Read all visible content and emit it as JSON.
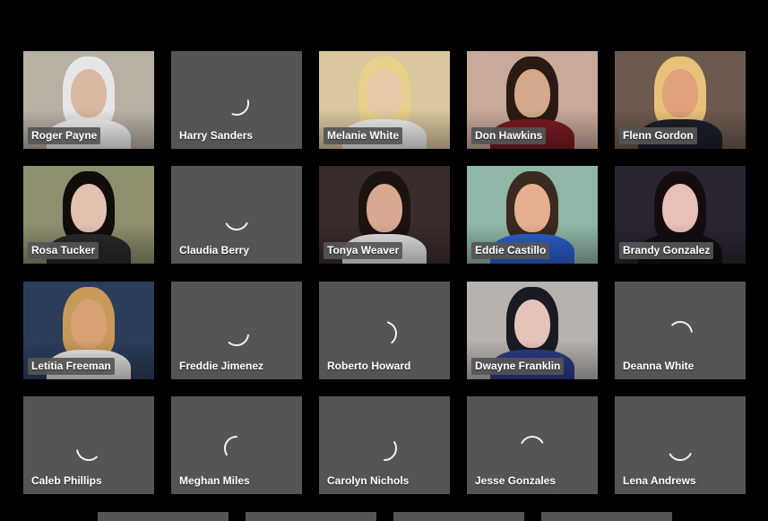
{
  "participants": [
    {
      "name": "Roger Payne",
      "video": true,
      "bg": "#b9b0a4",
      "skin": "#d9b7a0",
      "hair": "#e6e6e6",
      "shirt": "#f2f2f2"
    },
    {
      "name": "Harry Sanders",
      "video": false
    },
    {
      "name": "Melanie White",
      "video": true,
      "bg": "#d9c79e",
      "skin": "#e8c7a8",
      "hair": "#e7d08a",
      "shirt": "#efefef"
    },
    {
      "name": "Don Hawkins",
      "video": true,
      "bg": "#c8a99a",
      "skin": "#d4a88a",
      "hair": "#2a1a14",
      "shirt": "#7a1c22"
    },
    {
      "name": "Flenn Gordon",
      "video": true,
      "bg": "#6d5a4e",
      "skin": "#e0a07a",
      "hair": "#e8c27a",
      "shirt": "#1b1f2a"
    },
    {
      "name": "Rosa Tucker",
      "video": true,
      "bg": "#8f8e6e",
      "skin": "#e3c1b0",
      "hair": "#120c0a",
      "shirt": "#2a2a2a"
    },
    {
      "name": "Claudia Berry",
      "video": false
    },
    {
      "name": "Tonya Weaver",
      "video": true,
      "bg": "#3a2c2a",
      "skin": "#d8a890",
      "hair": "#1c1210",
      "shirt": "#e5e5e5"
    },
    {
      "name": "Eddie Castillo",
      "video": true,
      "bg": "#8fb6a6",
      "skin": "#e6b090",
      "hair": "#3a2a20",
      "shirt": "#2b5fd0"
    },
    {
      "name": "Brandy Gonzalez",
      "video": true,
      "bg": "#2a2430",
      "skin": "#e8c0b8",
      "hair": "#160c10",
      "shirt": "#101014"
    },
    {
      "name": "Letitia Freeman",
      "video": true,
      "bg": "#2c3d5a",
      "skin": "#d8a074",
      "hair": "#c89a5a",
      "shirt": "#e8e6e0"
    },
    {
      "name": "Freddie Jimenez",
      "video": false
    },
    {
      "name": "Roberto Howard",
      "video": false
    },
    {
      "name": "Dwayne Franklin",
      "video": true,
      "bg": "#b8b2ae",
      "skin": "#e5c3b8",
      "hair": "#1a1a22",
      "shirt": "#2d3a8a"
    },
    {
      "name": "Deanna White",
      "video": false
    },
    {
      "name": "Caleb Phillips",
      "video": false
    },
    {
      "name": "Meghan Miles",
      "video": false
    },
    {
      "name": "Carolyn Nichols",
      "video": false
    },
    {
      "name": "Jesse Gonzales",
      "video": false
    },
    {
      "name": "Lena Andrews",
      "video": false
    }
  ]
}
